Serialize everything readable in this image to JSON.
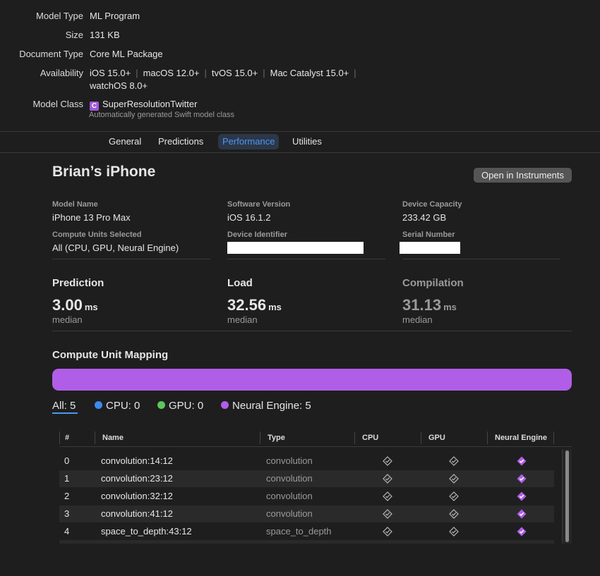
{
  "info": {
    "model_type": {
      "label": "Model Type",
      "value": "ML Program"
    },
    "size": {
      "label": "Size",
      "value": "131 KB"
    },
    "document_type": {
      "label": "Document Type",
      "value": "Core ML Package"
    },
    "availability": {
      "label": "Availability",
      "items": [
        "iOS 15.0+",
        "macOS 12.0+",
        "tvOS 15.0+",
        "Mac Catalyst 15.0+",
        "watchOS 8.0+"
      ]
    },
    "model_class": {
      "label": "Model Class",
      "badge": "C",
      "value": "SuperResolutionTwitter",
      "note": "Automatically generated Swift model class"
    }
  },
  "tabs": [
    "General",
    "Predictions",
    "Performance",
    "Utilities"
  ],
  "active_tab": "Performance",
  "device": {
    "title": "Brian’s iPhone",
    "instruments_button": "Open in Instruments",
    "model_name": {
      "label": "Model Name",
      "value": "iPhone 13 Pro Max"
    },
    "software_version": {
      "label": "Software Version",
      "value": "iOS 16.1.2"
    },
    "device_capacity": {
      "label": "Device Capacity",
      "value": "233.42 GB"
    },
    "compute_units": {
      "label": "Compute Units Selected",
      "value": "All (CPU, GPU, Neural Engine)"
    },
    "device_identifier": {
      "label": "Device Identifier"
    },
    "serial_number": {
      "label": "Serial Number"
    }
  },
  "metrics": [
    {
      "title": "Prediction",
      "value": "3.00",
      "unit": "ms",
      "sub": "median"
    },
    {
      "title": "Load",
      "value": "32.56",
      "unit": "ms",
      "sub": "median"
    },
    {
      "title": "Compilation",
      "value": "31.13",
      "unit": "ms",
      "sub": "median"
    }
  ],
  "mapping": {
    "title": "Compute Unit Mapping",
    "bar_color": "#b05ee8",
    "filters": {
      "all": "All: 5",
      "cpu": "CPU: 0",
      "gpu": "GPU: 0",
      "ne": "Neural Engine: 5"
    },
    "colors": {
      "cpu": "#3b8bf0",
      "gpu": "#5ac85a",
      "ne": "#b05ee8"
    }
  },
  "table": {
    "headers": {
      "index": "#",
      "name": "Name",
      "type": "Type",
      "cpu": "CPU",
      "gpu": "GPU",
      "ne": "Neural Engine"
    },
    "rows": [
      {
        "index": "0",
        "name": "convolution:14:12",
        "type": "convolution"
      },
      {
        "index": "1",
        "name": "convolution:23:12",
        "type": "convolution"
      },
      {
        "index": "2",
        "name": "convolution:32:12",
        "type": "convolution"
      },
      {
        "index": "3",
        "name": "convolution:41:12",
        "type": "convolution"
      },
      {
        "index": "4",
        "name": "space_to_depth:43:12",
        "type": "space_to_depth"
      }
    ]
  }
}
